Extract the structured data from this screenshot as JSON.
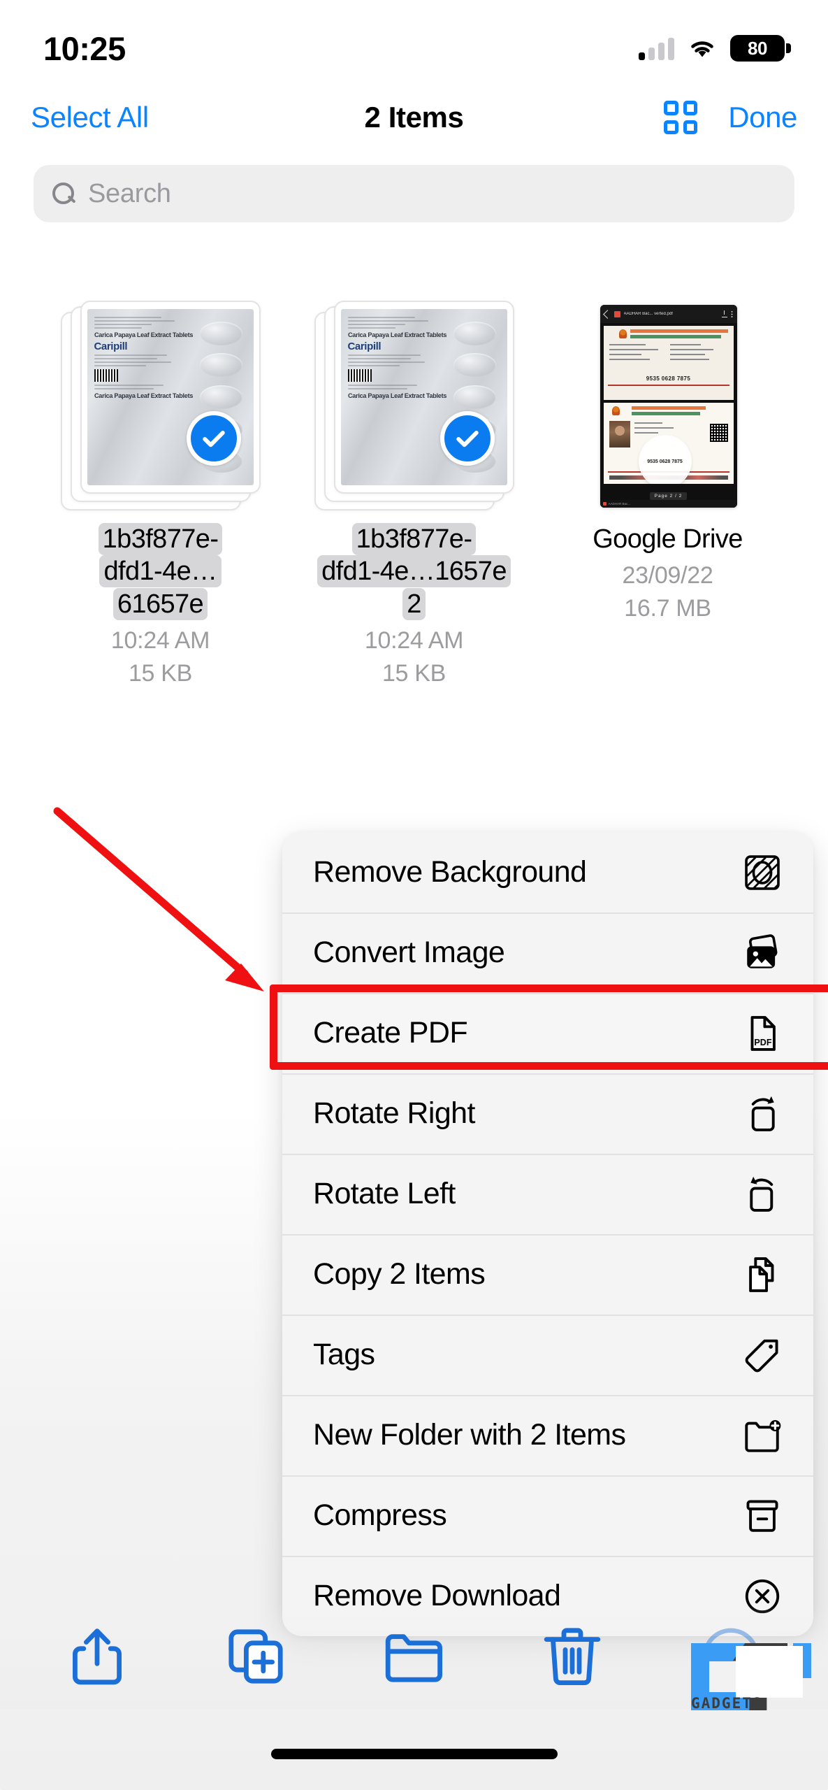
{
  "status_bar": {
    "time": "10:25",
    "battery_percent": "80",
    "signal_icon": "cellular-signal-icon",
    "wifi_icon": "wifi-icon",
    "battery_icon": "battery-icon"
  },
  "nav_bar": {
    "select_all_label": "Select All",
    "title": "2 Items",
    "grid_view_icon": "grid-view-icon",
    "done_label": "Done"
  },
  "search": {
    "placeholder": "Search",
    "value": "",
    "icon": "search-icon"
  },
  "files": [
    {
      "name_line1": "1b3f877e-",
      "name_line2": "dfd1-4e…61657e",
      "time": "10:24 AM",
      "size": "15 KB",
      "selected": true,
      "thumb_type": "image-stack",
      "thumb_text": {
        "title": "Carica Papaya Leaf Extract Tablets",
        "brand": "Caripill",
        "title2": "Carica Papaya Leaf Extract Tablets"
      }
    },
    {
      "name_line1": "1b3f877e-",
      "name_line2": "dfd1-4e…1657e 2",
      "time": "10:24 AM",
      "size": "15 KB",
      "selected": true,
      "thumb_type": "image-stack",
      "thumb_text": {
        "title": "Carica Papaya Leaf Extract Tablets",
        "brand": "Caripill",
        "title2": "Carica Papaya Leaf Extract Tablets"
      }
    },
    {
      "name_line1": "Google Drive",
      "name_line2": "",
      "time": "23/09/22",
      "size": "16.7 MB",
      "selected": false,
      "thumb_type": "folder-screenshot",
      "thumb_text": {
        "app_title": "AADHAR Bac... verted.pdf",
        "aadhaar_number": "9535 0628 7875",
        "page_indicator": "Page  2  /  2"
      }
    }
  ],
  "context_menu": [
    {
      "label": "Remove Background",
      "icon": "remove-background-icon",
      "highlighted": false
    },
    {
      "label": "Convert Image",
      "icon": "convert-image-icon",
      "highlighted": false
    },
    {
      "label": "Create PDF",
      "icon": "create-pdf-icon",
      "highlighted": true
    },
    {
      "label": "Rotate Right",
      "icon": "rotate-right-icon",
      "highlighted": false
    },
    {
      "label": "Rotate Left",
      "icon": "rotate-left-icon",
      "highlighted": false
    },
    {
      "label": "Copy 2 Items",
      "icon": "copy-icon",
      "highlighted": false
    },
    {
      "label": "Tags",
      "icon": "tag-icon",
      "highlighted": false
    },
    {
      "label": "New Folder with 2 Items",
      "icon": "new-folder-icon",
      "highlighted": false
    },
    {
      "label": "Compress",
      "icon": "compress-icon",
      "highlighted": false
    },
    {
      "label": "Remove Download",
      "icon": "remove-download-icon",
      "highlighted": false
    }
  ],
  "toolbar": [
    {
      "icon": "share-icon",
      "name": "share-button"
    },
    {
      "icon": "duplicate-icon",
      "name": "duplicate-button"
    },
    {
      "icon": "folder-icon",
      "name": "move-to-folder-button"
    },
    {
      "icon": "trash-icon",
      "name": "delete-button"
    },
    {
      "icon": "more-ellipsis-icon",
      "name": "more-actions-button"
    }
  ],
  "annotation": {
    "arrow_color": "#ef1111",
    "highlight_color": "#ef1111",
    "target": "Create PDF"
  },
  "watermark": {
    "text": "GADGETS",
    "accent_color": "#3b9cf5",
    "dark_color": "#3c3c3c"
  },
  "colors": {
    "accent_blue": "#0a84ff",
    "toolbar_blue": "#1c6fd6",
    "selection_blue": "#0a7cf0",
    "menu_bg": "#f4f4f5",
    "search_bg": "#eeeeef"
  }
}
